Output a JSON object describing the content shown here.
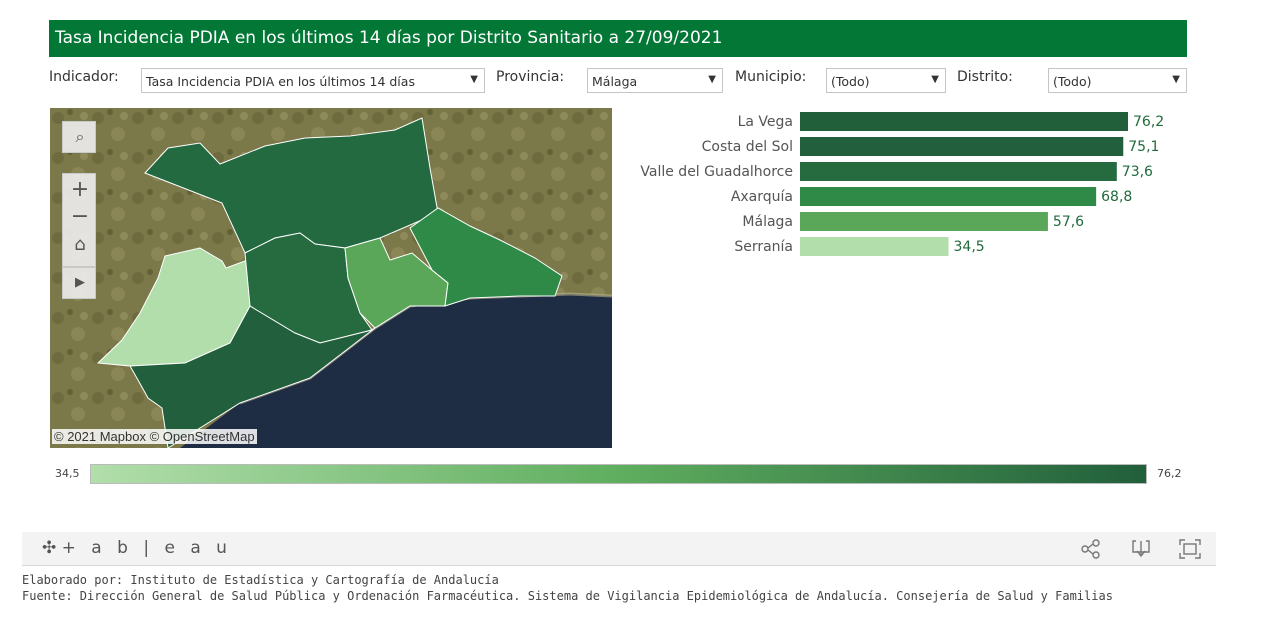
{
  "title": "Tasa Incidencia PDIA en los últimos 14 días por Distrito Sanitario a 27/09/2021",
  "filters": {
    "indicador": {
      "label": "Indicador:",
      "value": "Tasa Incidencia PDIA en los últimos 14 días"
    },
    "provincia": {
      "label": "Provincia:",
      "value": "Málaga"
    },
    "municipio": {
      "label": "Municipio:",
      "value": "(Todo)"
    },
    "distrito": {
      "label": "Distrito:",
      "value": "(Todo)"
    }
  },
  "map": {
    "attribution": "© 2021 Mapbox © OpenStreetMap",
    "tools": [
      "search-icon",
      "zoom-in-icon",
      "zoom-out-icon",
      "home-icon",
      "play-icon"
    ]
  },
  "chart_data": {
    "type": "bar",
    "orientation": "horizontal",
    "categories": [
      "La Vega",
      "Costa del Sol",
      "Valle del Guadalhorce",
      "Axarquía",
      "Málaga",
      "Serranía"
    ],
    "values": [
      76.2,
      75.1,
      73.6,
      68.8,
      57.6,
      34.5
    ],
    "value_labels": [
      "76,2",
      "75,1",
      "73,6",
      "68,8",
      "57,6",
      "34,5"
    ],
    "colors": [
      "#215f3b",
      "#225f3c",
      "#256b3f",
      "#2f8a47",
      "#5aa75a",
      "#b2deab"
    ],
    "color_scale": {
      "min_label": "34,5",
      "max_label": "76,2",
      "min_color": "#b2deab",
      "max_color": "#215f3b"
    }
  },
  "footer": {
    "logo": "+ a b | e a u",
    "icons": [
      "share-icon",
      "download-icon",
      "fullscreen-icon"
    ]
  },
  "credits": {
    "elaborado": "Elaborado por: Instituto de Estadística y Cartografía de Andalucía",
    "fuente": "Fuente: Dirección General de Salud Pública y Ordenación Farmacéutica. Sistema de Vigilancia Epidemiológica de Andalucía. Consejería de Salud y Familias"
  },
  "colors": {
    "title_bg": "#027736",
    "sea": "#1e2c44",
    "land": "#7d7a4c"
  }
}
